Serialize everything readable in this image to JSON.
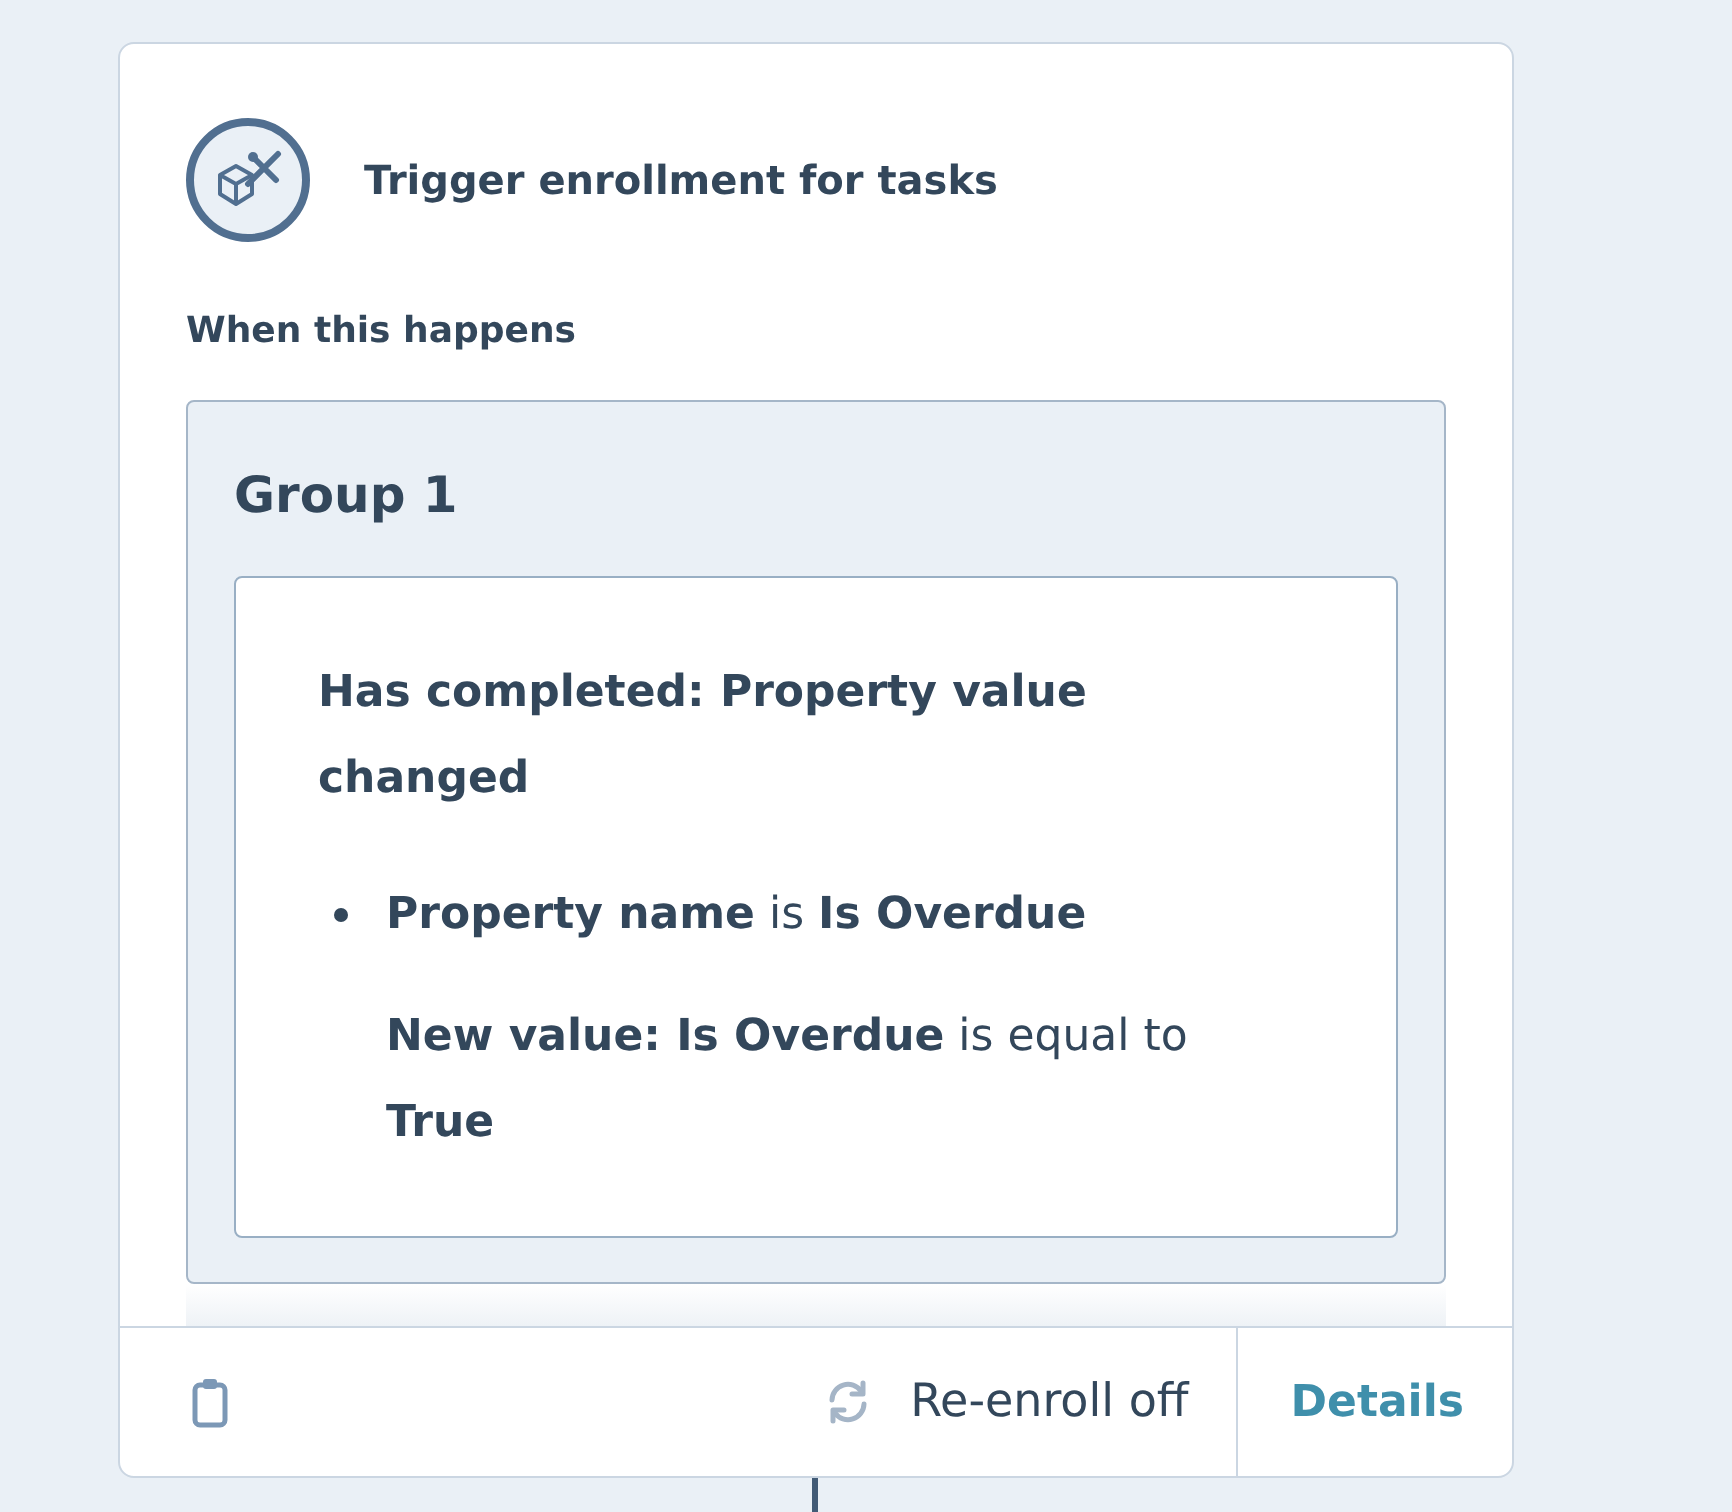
{
  "trigger": {
    "title": "Trigger enrollment for tasks",
    "section_label": "When this happens"
  },
  "groups": [
    {
      "title": "Group 1",
      "conditions": [
        {
          "heading": "Has completed: Property value changed",
          "filters": [
            {
              "lines": [
                "**Property name** is **Is Overdue**",
                "**New value: Is Overdue** is equal to **True**"
              ]
            }
          ]
        }
      ]
    }
  ],
  "footer": {
    "reenroll": "Re-enroll off",
    "details": "Details"
  }
}
